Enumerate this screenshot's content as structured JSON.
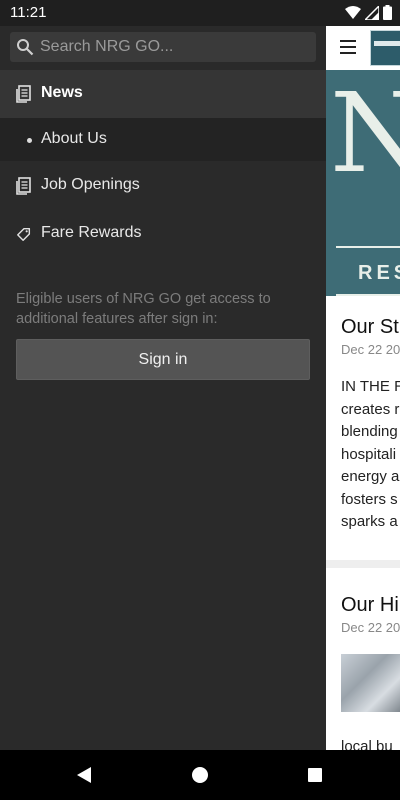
{
  "status_bar": {
    "time": "11:21",
    "icons": [
      "wifi-icon",
      "signal-icon",
      "battery-icon"
    ]
  },
  "drawer": {
    "search": {
      "placeholder": "Search NRG GO...",
      "value": ""
    },
    "items": [
      {
        "label": "News",
        "icon": "document-icon",
        "selected": true
      },
      {
        "label": "About Us",
        "icon": "bullet",
        "sub_item": true
      },
      {
        "label": "Job Openings",
        "icon": "document-icon"
      },
      {
        "label": "Fare Rewards",
        "icon": "tag-icon"
      }
    ],
    "signin_note": "Eligible users of NRG GO get access to additional features after sign in:",
    "signin_button": "Sign in"
  },
  "content": {
    "hero_letter": "N",
    "hero_text": "RES",
    "articles": [
      {
        "title": "Our St",
        "date": "Dec 22 20",
        "body_lines": [
          "IN THE R",
          "creates r",
          "blending",
          "hospitali",
          "energy a",
          "fosters s",
          "sparks a"
        ]
      },
      {
        "title": "Our Hi",
        "date": "Dec 22 20",
        "tail": "local bu"
      }
    ]
  },
  "colors": {
    "drawer_bg": "#2a2a2a",
    "selected_bg": "#353535",
    "hero_bg": "#3e6c76",
    "button_bg": "#545454"
  }
}
